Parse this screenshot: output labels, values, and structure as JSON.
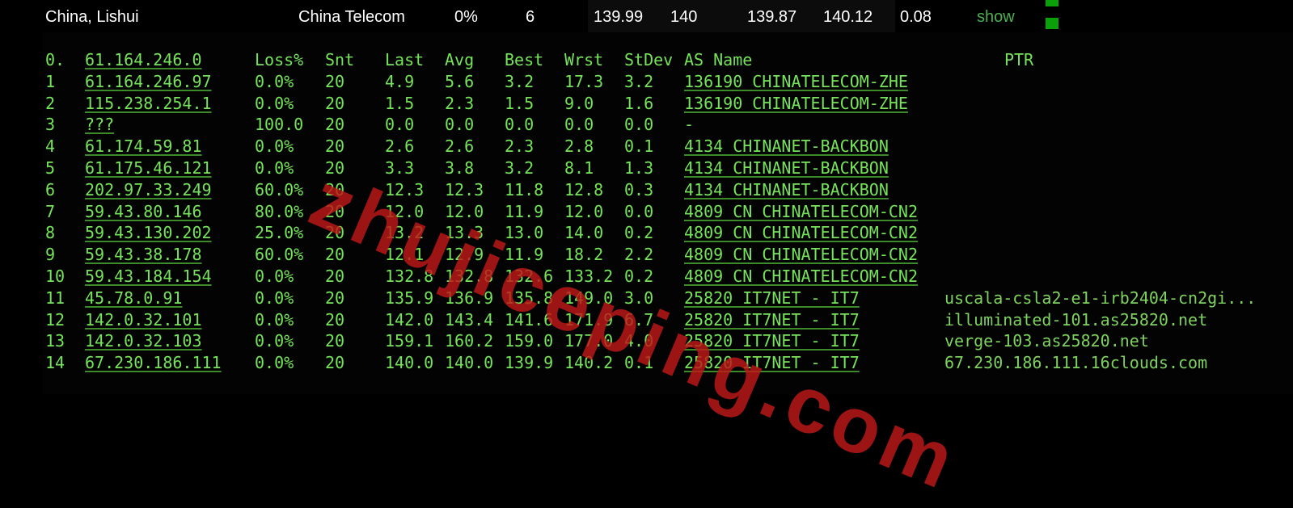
{
  "summary": {
    "location": "China, Lishui",
    "isp": "China Telecom",
    "loss": "0%",
    "sent": "6",
    "last": "139.99",
    "avg": "140",
    "best": "139.87",
    "worst": "140.12",
    "stdev": "0.08",
    "show_label": "show"
  },
  "headers": {
    "index": "0.",
    "host": "61.164.246.0",
    "loss": "Loss%",
    "snt": "Snt",
    "last": "Last",
    "avg": "Avg",
    "best": "Best",
    "wrst": "Wrst",
    "stdev": "StDev",
    "as_name": "AS Name",
    "ptr": "PTR"
  },
  "hops": [
    {
      "n": "1",
      "host": "61.164.246.97",
      "loss": "0.0%",
      "snt": "20",
      "last": "4.9",
      "avg": "5.6",
      "best": "3.2",
      "wrst": "17.3",
      "stdev": "3.2",
      "as": "136190 CHINATELECOM-ZHE",
      "ptr": ""
    },
    {
      "n": "2",
      "host": "115.238.254.1",
      "loss": "0.0%",
      "snt": "20",
      "last": "1.5",
      "avg": "2.3",
      "best": "1.5",
      "wrst": "9.0",
      "stdev": "1.6",
      "as": "136190 CHINATELECOM-ZHE",
      "ptr": ""
    },
    {
      "n": "3",
      "host": "???",
      "loss": "100.0",
      "snt": "20",
      "last": "0.0",
      "avg": "0.0",
      "best": "0.0",
      "wrst": "0.0",
      "stdev": "0.0",
      "as": "-",
      "ptr": ""
    },
    {
      "n": "4",
      "host": "61.174.59.81",
      "loss": "0.0%",
      "snt": "20",
      "last": "2.6",
      "avg": "2.6",
      "best": "2.3",
      "wrst": "2.8",
      "stdev": "0.1",
      "as": "4134  CHINANET-BACKBON",
      "ptr": ""
    },
    {
      "n": "5",
      "host": "61.175.46.121",
      "loss": "0.0%",
      "snt": "20",
      "last": "3.3",
      "avg": "3.8",
      "best": "3.2",
      "wrst": "8.1",
      "stdev": "1.3",
      "as": "4134  CHINANET-BACKBON",
      "ptr": ""
    },
    {
      "n": "6",
      "host": "202.97.33.249",
      "loss": "60.0%",
      "snt": "20",
      "last": "12.3",
      "avg": "12.3",
      "best": "11.8",
      "wrst": "12.8",
      "stdev": "0.3",
      "as": "4134  CHINANET-BACKBON",
      "ptr": ""
    },
    {
      "n": "7",
      "host": "59.43.80.146",
      "loss": "80.0%",
      "snt": "20",
      "last": "12.0",
      "avg": "12.0",
      "best": "11.9",
      "wrst": "12.0",
      "stdev": "0.0",
      "as": "4809  CN CHINATELECOM-CN2",
      "ptr": ""
    },
    {
      "n": "8",
      "host": "59.43.130.202",
      "loss": "25.0%",
      "snt": "20",
      "last": "13.2",
      "avg": "13.3",
      "best": "13.0",
      "wrst": "14.0",
      "stdev": "0.2",
      "as": "4809  CN CHINATELECOM-CN2",
      "ptr": ""
    },
    {
      "n": "9",
      "host": "59.43.38.178",
      "loss": "60.0%",
      "snt": "20",
      "last": "12.1",
      "avg": "12.9",
      "best": "11.9",
      "wrst": "18.2",
      "stdev": "2.2",
      "as": "4809  CN CHINATELECOM-CN2",
      "ptr": ""
    },
    {
      "n": "10",
      "host": "59.43.184.154",
      "loss": "0.0%",
      "snt": "20",
      "last": "132.8",
      "avg": "132.8",
      "best": "132.6",
      "wrst": "133.2",
      "stdev": "0.2",
      "as": "4809  CN CHINATELECOM-CN2",
      "ptr": ""
    },
    {
      "n": "11",
      "host": "45.78.0.91",
      "loss": "0.0%",
      "snt": "20",
      "last": "135.9",
      "avg": "136.9",
      "best": "135.8",
      "wrst": "149.0",
      "stdev": "3.0",
      "as": "25820 IT7NET - IT7",
      "ptr": "uscala-csla2-e1-irb2404-cn2gi..."
    },
    {
      "n": "12",
      "host": "142.0.32.101",
      "loss": "0.0%",
      "snt": "20",
      "last": "142.0",
      "avg": "143.4",
      "best": "141.6",
      "wrst": "171.9",
      "stdev": "6.7",
      "as": "25820 IT7NET - IT7",
      "ptr": "illuminated-101.as25820.net"
    },
    {
      "n": "13",
      "host": "142.0.32.103",
      "loss": "0.0%",
      "snt": "20",
      "last": "159.1",
      "avg": "160.2",
      "best": "159.0",
      "wrst": "177.0",
      "stdev": "4.0",
      "as": "25820 IT7NET - IT7",
      "ptr": "verge-103.as25820.net"
    },
    {
      "n": "14",
      "host": "67.230.186.111",
      "loss": "0.0%",
      "snt": "20",
      "last": "140.0",
      "avg": "140.0",
      "best": "139.9",
      "wrst": "140.2",
      "stdev": "0.1",
      "as": "25820 IT7NET - IT7",
      "ptr": "67.230.186.111.16clouds.com"
    }
  ],
  "watermark": "zhujiceping.com",
  "colors": {
    "text_green": "#76e45a",
    "watermark_red": "#be1919",
    "background": "#000000",
    "indicator_green": "#0aa00a"
  }
}
